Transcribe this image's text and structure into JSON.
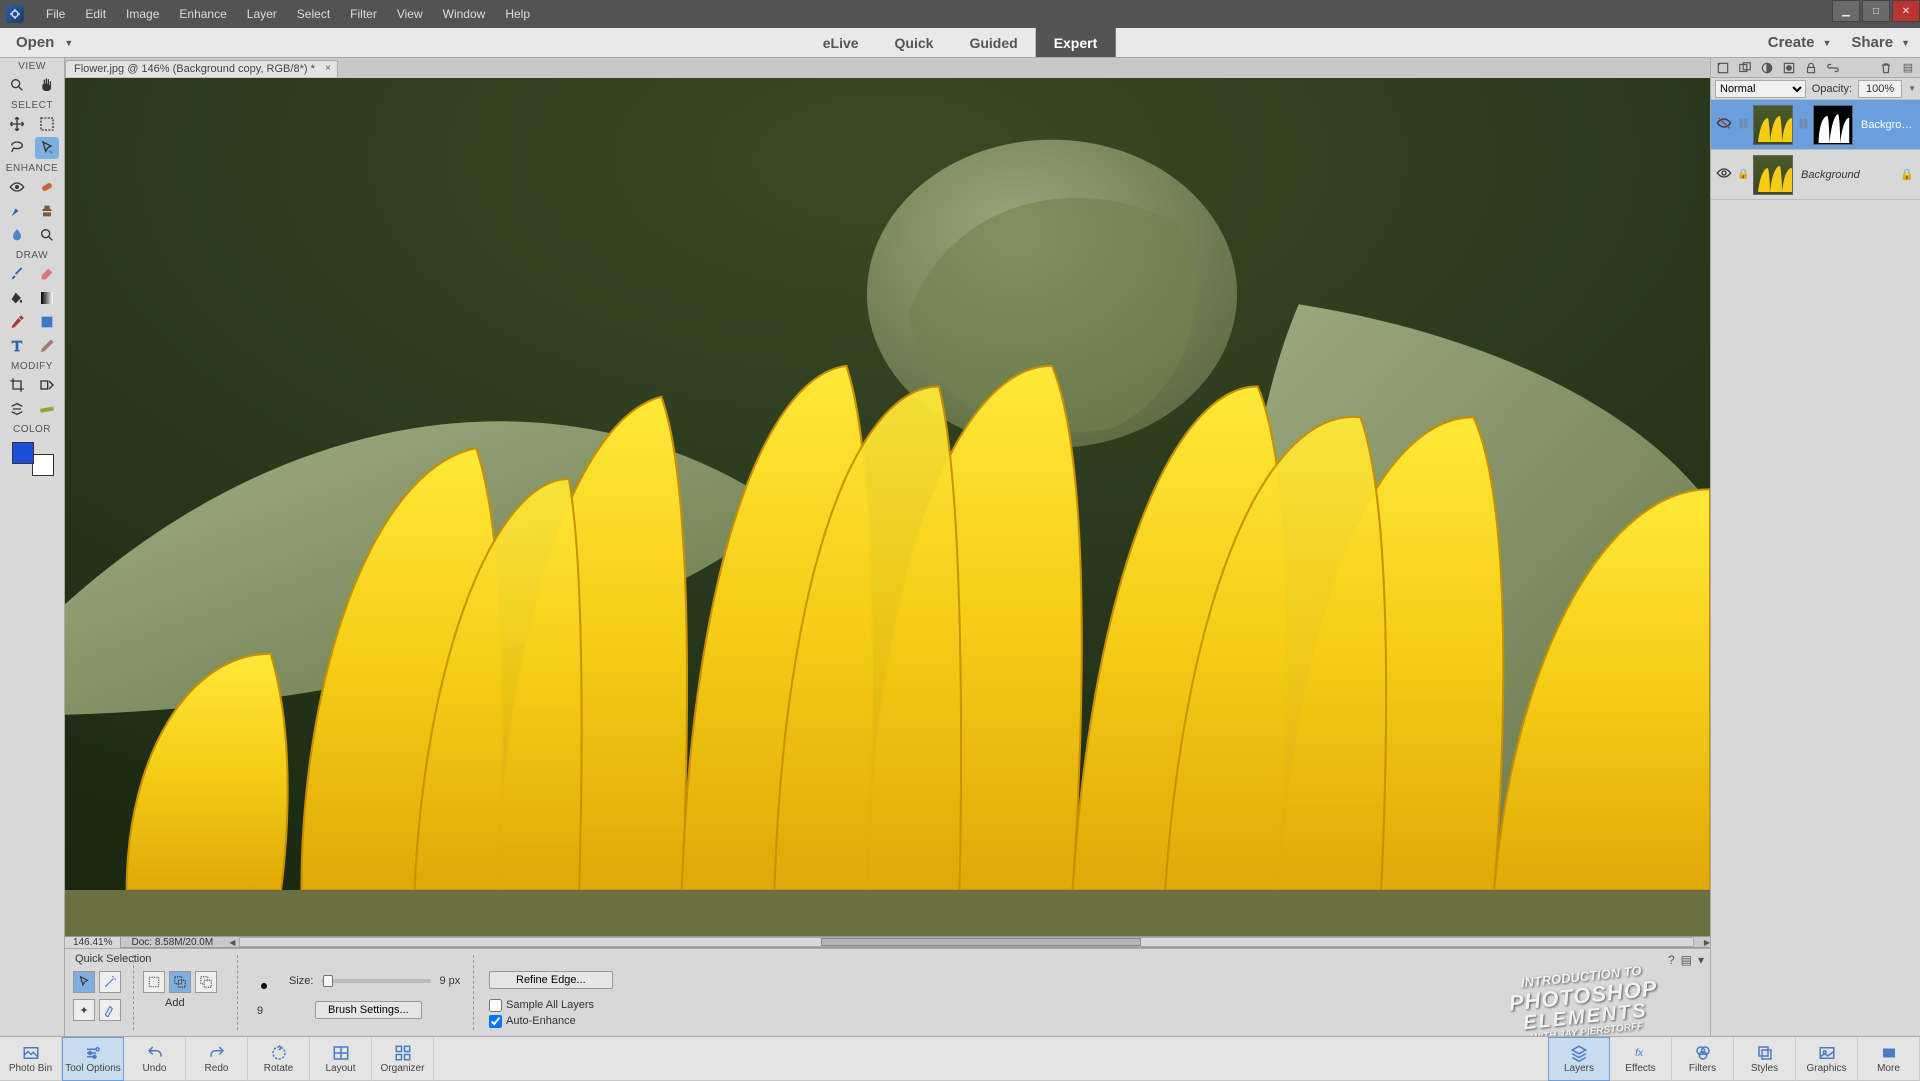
{
  "menu": {
    "items": [
      "File",
      "Edit",
      "Image",
      "Enhance",
      "Layer",
      "Select",
      "Filter",
      "View",
      "Window",
      "Help"
    ]
  },
  "modebar": {
    "open": "Open",
    "tabs": [
      "eLive",
      "Quick",
      "Guided",
      "Expert"
    ],
    "active_tab": "Expert",
    "create": "Create",
    "share": "Share"
  },
  "document": {
    "tab_title": "Flower.jpg @ 146% (Background copy, RGB/8*) *"
  },
  "tools": {
    "sections": {
      "view": "VIEW",
      "select": "SELECT",
      "enhance": "ENHANCE",
      "draw": "DRAW",
      "modify": "MODIFY",
      "color": "COLOR"
    },
    "fg_color": "#1d4ed8",
    "bg_color": "#ffffff"
  },
  "status": {
    "zoom": "146.41%",
    "doc": "Doc: 8.58M/20.0M"
  },
  "tool_options": {
    "title": "Quick Selection",
    "add_label": "Add",
    "size_label": "Size:",
    "size_value": "9 px",
    "size_number": "9",
    "brush_settings": "Brush Settings...",
    "refine_edge": "Refine Edge...",
    "sample_all": "Sample All Layers",
    "auto_enhance": "Auto-Enhance",
    "logo": {
      "l1": "INTRODUCTION TO",
      "l2": "PHOTOSHOP",
      "l3": "ELEMENTS",
      "l4": "WITH JAY PIERSTORFF"
    }
  },
  "bottom": {
    "items": [
      "Photo Bin",
      "Tool Options",
      "Undo",
      "Redo",
      "Rotate",
      "Layout",
      "Organizer"
    ],
    "right_items": [
      "Layers",
      "Effects",
      "Filters",
      "Styles",
      "Graphics",
      "More"
    ],
    "active_left": "Tool Options",
    "active_right": "Layers"
  },
  "layers": {
    "blend_mode": "Normal",
    "opacity_label": "Opacity:",
    "opacity_value": "100%",
    "items": [
      {
        "name": "Backgrou...",
        "visible": false,
        "selected": true,
        "has_mask": true,
        "italic": false
      },
      {
        "name": "Background",
        "visible": true,
        "selected": false,
        "has_mask": false,
        "italic": true,
        "locked": true
      }
    ]
  }
}
